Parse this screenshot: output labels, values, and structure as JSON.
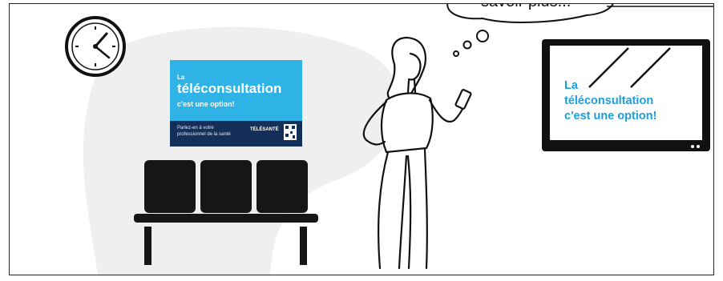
{
  "poster": {
    "la": "La",
    "title": "téléconsultation",
    "subtitle": "c'est une option!",
    "body_line1": "Parlez-en à votre",
    "body_line2": "professionnel de la santé",
    "brand": "TÉLÉSANTÉ"
  },
  "tv": {
    "line1": "La",
    "line2": "téléconsultation",
    "line3": "c'est une option!"
  },
  "thought_bubble": {
    "text": "savoir plus..."
  },
  "colors": {
    "accent_blue": "#1a9fde",
    "poster_blue": "#2fb2e6",
    "poster_navy": "#14305a",
    "background_shape": "#efefef",
    "outline": "#111111"
  },
  "icons": [
    "clock-icon",
    "smartphone-icon",
    "qr-code-icon"
  ]
}
